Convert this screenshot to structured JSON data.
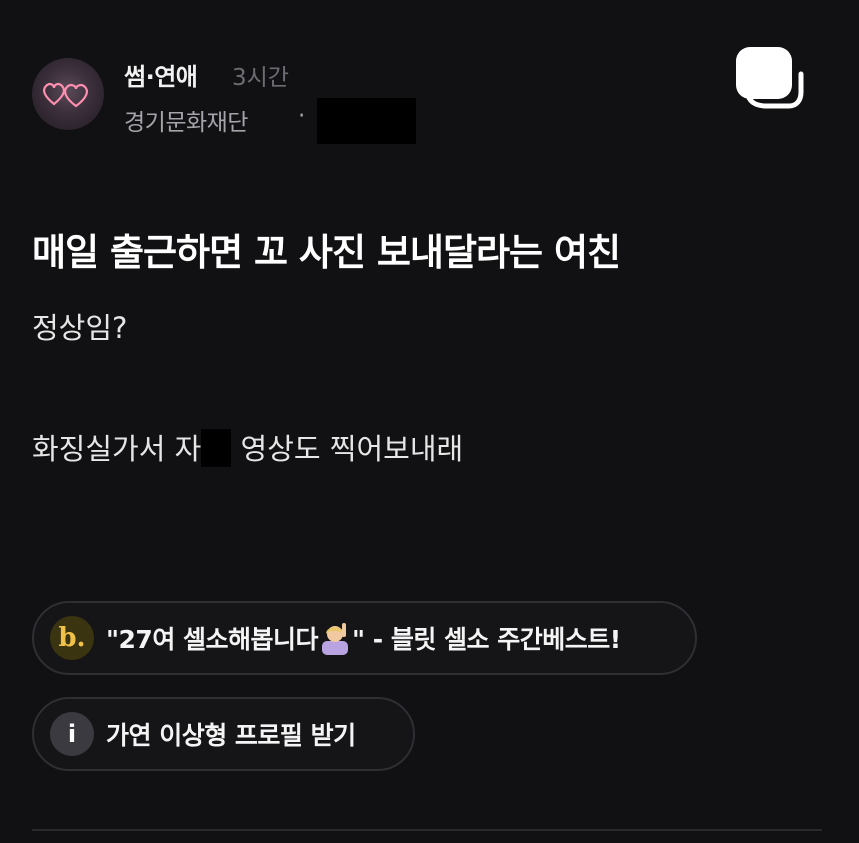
{
  "post": {
    "channel": "썸·연애",
    "time": "3시간",
    "company": "경기문화재단",
    "separator": "·",
    "title": "매일 출근하면 꼬 사진 보내달라는 여친",
    "body_line1": "정상임?",
    "body_line2_before": "화징실가서 자",
    "body_line2_after": "영상도 찍어보내래"
  },
  "promos": [
    {
      "icon": "b-logo-icon",
      "icon_text": "b.",
      "label_before": "\"27여 셀소해봅니다",
      "label_after": "\" - 블릿 셀소 주간베스트!"
    },
    {
      "icon": "info-icon",
      "icon_text": "i",
      "label": "가연 이상형 프로필 받기"
    }
  ],
  "colors": {
    "background": "#111113",
    "pill_border": "#2e2e33",
    "muted_text": "#a4a4aa",
    "accent_yellow": "#f1c24a"
  }
}
